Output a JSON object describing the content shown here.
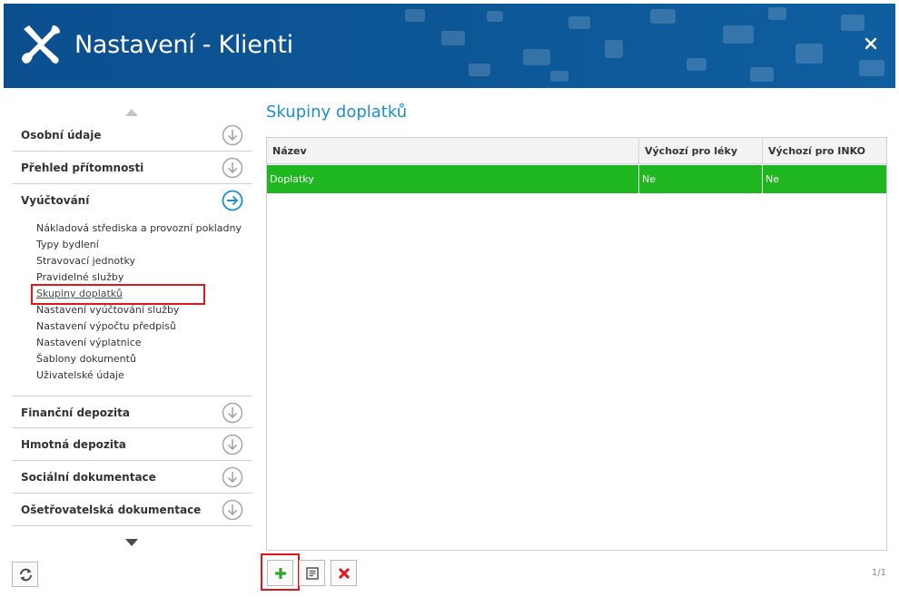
{
  "window": {
    "title": "Nastavení - Klienti",
    "close_icon": "close-icon",
    "header_icon": "wrench-screwdriver-icon"
  },
  "sidebar": {
    "sections_top": [
      {
        "label": "Osobní údaje",
        "icon": "arrow-down-circle-icon"
      },
      {
        "label": "Přehled přítomnosti",
        "icon": "arrow-down-circle-icon"
      },
      {
        "label": "Vyúčtování",
        "icon": "arrow-right-circle-icon",
        "expanded": true
      }
    ],
    "subitems": [
      {
        "label": "Nákladová střediska a provozní pokladny"
      },
      {
        "label": "Typy bydlení"
      },
      {
        "label": "Stravovací jednotky"
      },
      {
        "label": "Pravidelné služby"
      },
      {
        "label": "Skupiny doplatků",
        "active": true
      },
      {
        "label": "Nastavení vyúčtování služby"
      },
      {
        "label": "Nastavení výpočtu předpisů"
      },
      {
        "label": "Nastavení výplatnice"
      },
      {
        "label": "Šablony dokumentů"
      },
      {
        "label": "Uživatelské údaje"
      }
    ],
    "sections_bottom": [
      {
        "label": "Finanční depozita",
        "icon": "arrow-down-circle-icon"
      },
      {
        "label": "Hmotná depozita",
        "icon": "arrow-down-circle-icon"
      },
      {
        "label": "Sociální dokumentace",
        "icon": "arrow-down-circle-icon"
      },
      {
        "label": "Ošetřovatelská dokumentace",
        "icon": "arrow-down-circle-icon"
      }
    ]
  },
  "main": {
    "title": "Skupiny doplatků",
    "table": {
      "columns": [
        "Název",
        "Výchozí pro léky",
        "Výchozí pro INKO"
      ],
      "rows": [
        [
          "Doplatky",
          "Ne",
          "Ne"
        ]
      ]
    },
    "pager": "1/1"
  },
  "colors": {
    "header_bg": "#0d5797",
    "accent": "#1b8fd0",
    "selected_row": "#1fb71f",
    "highlight": "#e0151e"
  }
}
